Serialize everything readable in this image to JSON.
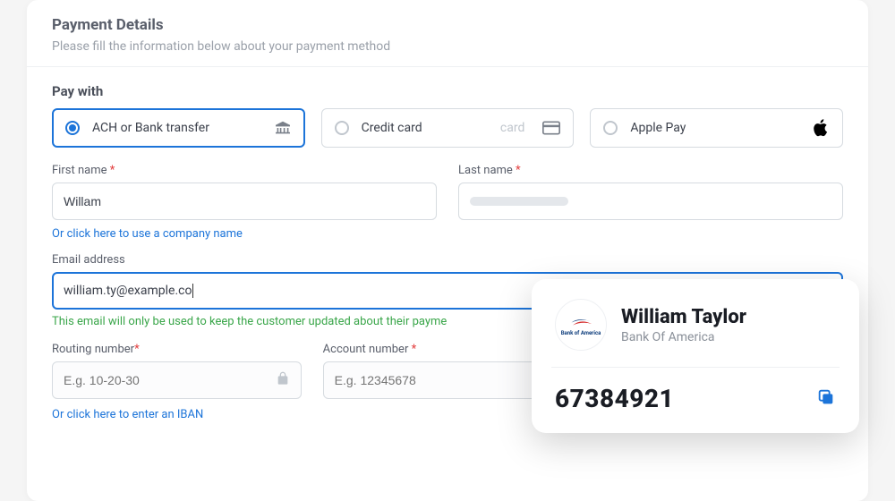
{
  "header": {
    "title": "Payment Details",
    "subtitle": "Please fill the information below about your payment method"
  },
  "pay_with": {
    "label": "Pay with",
    "options": [
      {
        "label": "ACH or Bank transfer",
        "selected": true
      },
      {
        "label": "Credit card",
        "ghost": "card",
        "selected": false
      },
      {
        "label": "Apple Pay",
        "selected": false
      }
    ]
  },
  "fields": {
    "first_name": {
      "label": "First name",
      "value": "Willam",
      "required": true
    },
    "last_name": {
      "label": "Last name",
      "value": "",
      "required": true
    },
    "company_link": "Or click here to use a company name",
    "email": {
      "label": "Email address",
      "value": "william.ty@example.co",
      "helper": "This email will only be used to keep the customer updated about their payme"
    },
    "routing": {
      "label": "Routing number",
      "placeholder": "E.g. 10-20-30",
      "required": true
    },
    "account": {
      "label": "Account number",
      "placeholder": "E.g. 12345678",
      "required": true
    },
    "iban_link": "Or click here to enter an IBAN"
  },
  "bank_card": {
    "name": "William Taylor",
    "bank": "Bank Of America",
    "logo_text": "Bank of America",
    "number": "67384921"
  }
}
